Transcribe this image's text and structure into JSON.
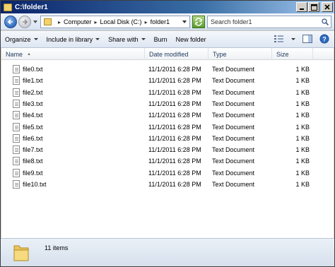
{
  "window": {
    "title": "C:\\folder1"
  },
  "address": {
    "crumbs": [
      "Computer",
      "Local Disk (C:)",
      "folder1"
    ]
  },
  "search": {
    "placeholder": "Search folder1"
  },
  "toolbar": {
    "organize": "Organize",
    "include_in_library": "Include in library",
    "share_with": "Share with",
    "burn": "Burn",
    "new_folder": "New folder"
  },
  "columns": {
    "name": "Name",
    "date_modified": "Date modified",
    "type": "Type",
    "size": "Size"
  },
  "files": [
    {
      "name": "file0.txt",
      "date": "11/1/2011 6:28 PM",
      "type": "Text Document",
      "size": "1 KB"
    },
    {
      "name": "file1.txt",
      "date": "11/1/2011 6:28 PM",
      "type": "Text Document",
      "size": "1 KB"
    },
    {
      "name": "file2.txt",
      "date": "11/1/2011 6:28 PM",
      "type": "Text Document",
      "size": "1 KB"
    },
    {
      "name": "file3.txt",
      "date": "11/1/2011 6:28 PM",
      "type": "Text Document",
      "size": "1 KB"
    },
    {
      "name": "file4.txt",
      "date": "11/1/2011 6:28 PM",
      "type": "Text Document",
      "size": "1 KB"
    },
    {
      "name": "file5.txt",
      "date": "11/1/2011 6:28 PM",
      "type": "Text Document",
      "size": "1 KB"
    },
    {
      "name": "file6.txt",
      "date": "11/1/2011 6:28 PM",
      "type": "Text Document",
      "size": "1 KB"
    },
    {
      "name": "file7.txt",
      "date": "11/1/2011 6:28 PM",
      "type": "Text Document",
      "size": "1 KB"
    },
    {
      "name": "file8.txt",
      "date": "11/1/2011 6:28 PM",
      "type": "Text Document",
      "size": "1 KB"
    },
    {
      "name": "file9.txt",
      "date": "11/1/2011 6:28 PM",
      "type": "Text Document",
      "size": "1 KB"
    },
    {
      "name": "file10.txt",
      "date": "11/1/2011 6:28 PM",
      "type": "Text Document",
      "size": "1 KB"
    }
  ],
  "status": {
    "item_count": "11 items"
  }
}
